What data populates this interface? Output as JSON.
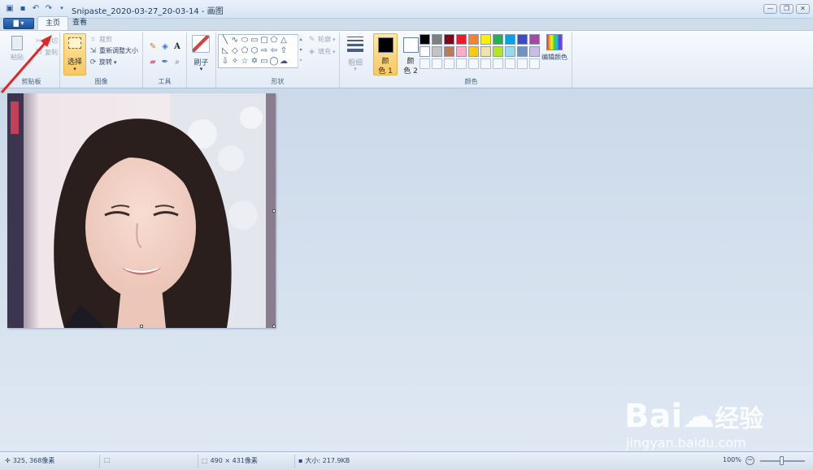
{
  "window": {
    "title": "Snipaste_2020-03-27_20-03-14 - 画图",
    "file_tab": "▇ ▾",
    "controls": [
      "—",
      "❐",
      "✕"
    ]
  },
  "tabs": [
    {
      "label": "主页",
      "active": true
    },
    {
      "label": "查看",
      "active": false
    }
  ],
  "ribbon": {
    "clipboard": {
      "paste": "粘贴",
      "cut": "剪切",
      "copy": "复制",
      "label": "剪贴板"
    },
    "image": {
      "select": "选择",
      "crop": "裁剪",
      "resize": "重新调整大小",
      "rotate": "旋转",
      "label": "图像"
    },
    "tools": {
      "label": "工具"
    },
    "brushes": {
      "label": "刷子"
    },
    "shapes": {
      "outline": "轮廓",
      "fill": "填充",
      "label": "形状"
    },
    "size": {
      "label": "粗细"
    },
    "colors": {
      "color1_line1": "颜",
      "color1_line2": "色 1",
      "color2_line1": "颜",
      "color2_line2": "色 2",
      "edit": "编辑颜色",
      "label": "颜色",
      "color1_value": "#000000",
      "color2_value": "#ffffff",
      "palette_row1": [
        "#000000",
        "#7f7f7f",
        "#880015",
        "#ed1c24",
        "#ff7f27",
        "#fff200",
        "#22b14c",
        "#00a2e8",
        "#3f48cc",
        "#a349a4"
      ],
      "palette_row2": [
        "#ffffff",
        "#c3c3c3",
        "#b97a57",
        "#ffaec9",
        "#ffc90e",
        "#efe4b0",
        "#b5e61d",
        "#99d9ea",
        "#7092be",
        "#c8bfe7"
      ]
    }
  },
  "status": {
    "cursor_position": "325, 368像素",
    "image_dimensions": "490 × 431像素",
    "file_size": "大小: 217.9KB",
    "zoom": "100%"
  },
  "watermark": {
    "logo_text": "Bai",
    "logo_text2": "经验",
    "url": "jingyan.baidu.com"
  }
}
